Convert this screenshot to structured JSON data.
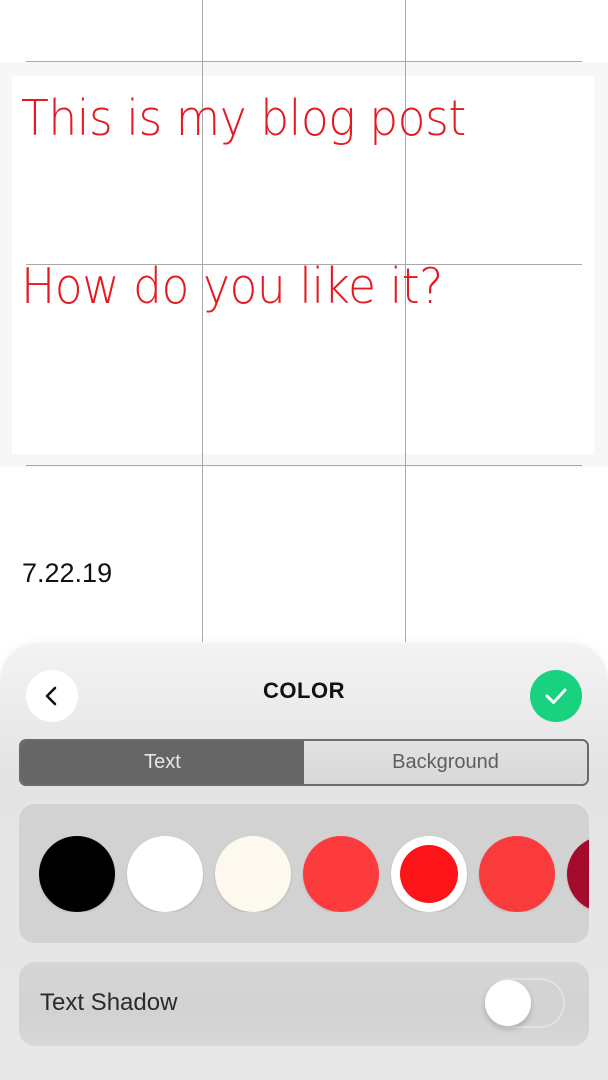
{
  "canvas": {
    "blog_lines": [
      "This is my blog post",
      "How do you like it?"
    ],
    "text_color": "#e5191f",
    "date": "7.22.19"
  },
  "panel": {
    "title": "COLOR",
    "back_icon": "chevron-left-icon",
    "confirm_icon": "checkmark-icon",
    "confirm_color": "#18d27f",
    "tabs": [
      {
        "label": "Text",
        "active": true
      },
      {
        "label": "Background",
        "active": false
      }
    ],
    "swatches": [
      {
        "name": "black",
        "color": "#000000",
        "selected": false
      },
      {
        "name": "white",
        "color": "#ffffff",
        "selected": false
      },
      {
        "name": "cream",
        "color": "#fdf9ee",
        "selected": false
      },
      {
        "name": "coral-red",
        "color": "#fd3a3c",
        "selected": false
      },
      {
        "name": "bright-red",
        "color": "#fc1418",
        "selected": true
      },
      {
        "name": "tomato-red",
        "color": "#f93b3b",
        "selected": false
      },
      {
        "name": "crimson",
        "color": "#a30a2c",
        "selected": false
      }
    ],
    "text_shadow": {
      "label": "Text Shadow",
      "enabled": false
    }
  }
}
